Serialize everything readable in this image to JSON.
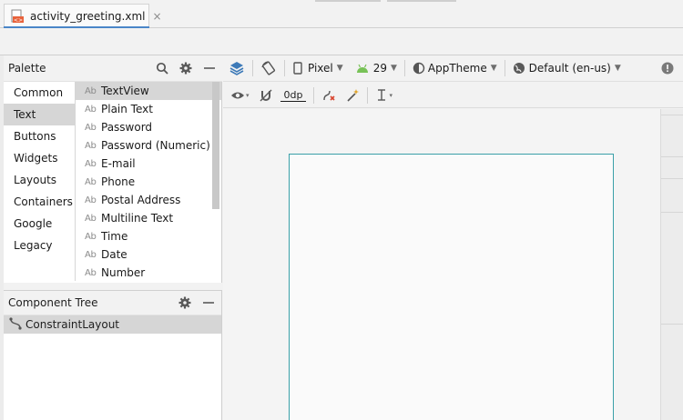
{
  "tab": {
    "filename": "activity_greeting.xml",
    "close": "×",
    "icon": "xml-file-icon"
  },
  "palette": {
    "title": "Palette",
    "categories": [
      "Common",
      "Text",
      "Buttons",
      "Widgets",
      "Layouts",
      "Containers",
      "Google",
      "Legacy"
    ],
    "selected_category": "Text",
    "widgets": [
      "TextView",
      "Plain Text",
      "Password",
      "Password (Numeric)",
      "E-mail",
      "Phone",
      "Postal Address",
      "Multiline Text",
      "Time",
      "Date",
      "Number"
    ],
    "widget_badge": "Ab"
  },
  "tree": {
    "title": "Component Tree",
    "root": "ConstraintLayout"
  },
  "toolbar": {
    "device": "Pixel",
    "api": "29",
    "theme": "AppTheme",
    "locale": "Default (en-us)",
    "margin": "0dp"
  },
  "colors": {
    "accent": "#4a86c8",
    "frame": "#3aa0a8",
    "android_green": "#78c257",
    "selection": "#d6d6d6"
  }
}
